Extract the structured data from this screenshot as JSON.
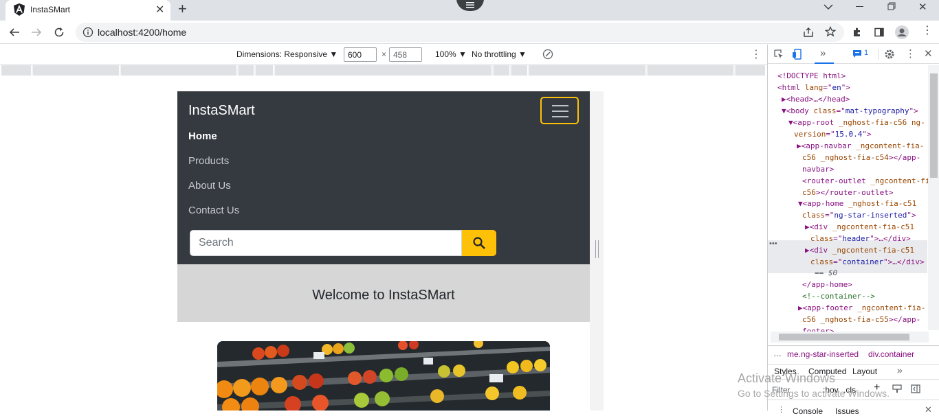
{
  "browser": {
    "tab_title": "InstaSMart",
    "url": "localhost:4200/home"
  },
  "device_toolbar": {
    "dimensions_label": "Dimensions: Responsive",
    "width": "600",
    "times": "×",
    "height": "458",
    "zoom": "100%",
    "throttling": "No throttling"
  },
  "app": {
    "brand": "InstaSMart",
    "nav": [
      "Home",
      "Products",
      "About Us",
      "Contact Us"
    ],
    "search_placeholder": "Search",
    "welcome": "Welcome to InstaSMart"
  },
  "devtools": {
    "issues_count": "1",
    "code_lines": [
      [
        "<!DOCTYPE html>"
      ],
      [
        "<html ",
        "lang",
        "=\"",
        "en",
        "\">"
      ],
      [
        "▶<head>…</head>"
      ],
      [
        "▼<body ",
        "class",
        "=\"",
        "mat-typography",
        "\">"
      ],
      [
        "▼<app-root ",
        "_nghost-fia-c56 ng-"
      ],
      [
        "version",
        "=\"",
        "15.0.4",
        "\">"
      ],
      [
        "▶<app-navbar ",
        "_ngcontent-fia-"
      ],
      [
        "c56 _nghost-fia-c54",
        "></app-"
      ],
      [
        "navbar>"
      ],
      [
        "<router-outlet ",
        "_ngcontent-fi"
      ],
      [
        "c56",
        "></router-outlet>"
      ],
      [
        "▼<app-home ",
        "_nghost-fia-c51"
      ],
      [
        "class",
        "=\"",
        "ng-star-inserted",
        "\">"
      ],
      [
        "▶<div ",
        "_ngcontent-fia-c51"
      ],
      [
        "class",
        "=\"",
        "header",
        "\">…</div>"
      ],
      [
        "▶<div ",
        "_ngcontent-fia-c51"
      ],
      [
        "class",
        "=\"",
        "container",
        "\">…</div>"
      ],
      [
        "== $0"
      ],
      [
        "</app-home>"
      ],
      [
        "<!--container-->"
      ],
      [
        "▶<app-footer ",
        "_ngcontent-fia-"
      ],
      [
        "c56 _nghost-fia-c55",
        "></app-"
      ],
      [
        "footer>"
      ]
    ],
    "breadcrumb": [
      "…",
      "me.ng-star-inserted",
      "div.container"
    ],
    "tabs": [
      "Styles",
      "Computed",
      "Layout",
      "»"
    ],
    "filter_placeholder": "Filter",
    "filter_options": [
      ":hov",
      ".cls"
    ],
    "drawer_tabs": [
      "Console",
      "Issues"
    ]
  },
  "watermark": {
    "line1": "Activate Windows",
    "line2": "Go to Settings to activate Windows."
  }
}
